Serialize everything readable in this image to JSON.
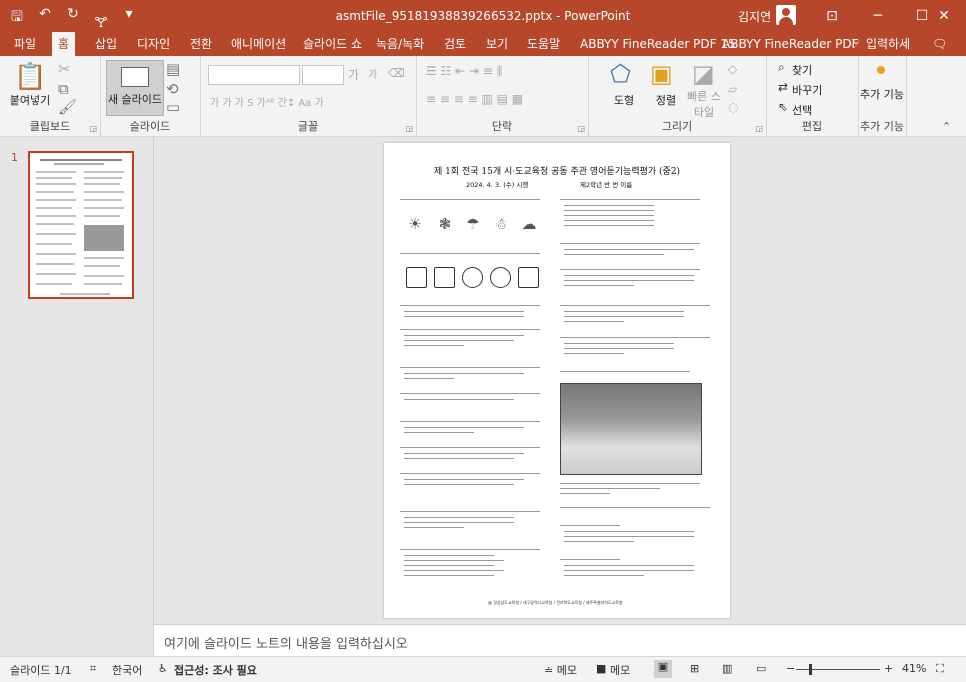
{
  "window": {
    "title": "asmtFile_95181938839266532.pptx  -  PowerPoint",
    "user": "김지연",
    "controls": {
      "ribbon_display": "⊡",
      "minimize": "─",
      "maximize": "☐",
      "close": "✕"
    }
  },
  "qat": {
    "save": "🖫",
    "undo": "↶",
    "redo": "↻",
    "present": "🝖",
    "more": "▾"
  },
  "menu": {
    "tabs": [
      "파일",
      "홈",
      "삽입",
      "디자인",
      "전환",
      "애니메이션",
      "슬라이드 쇼",
      "녹음/녹화",
      "검토",
      "보기",
      "도움말",
      "ABBYY FineReader PDF 15",
      "ABBYY FineReader PDF"
    ],
    "active": "홈",
    "search": "입력하세",
    "comment_icon": "🗨"
  },
  "ribbon": {
    "clipboard": {
      "paste": "붙여넣기",
      "label": "클립보드"
    },
    "slides": {
      "new_slide": "새 슬라이드",
      "label": "슬라이드"
    },
    "font": {
      "label": "글꼴",
      "grow": "가",
      "shrink": "가",
      "aa": "Aa",
      "color_a": "가",
      "font_row": "가 가 가 S 가ᴬᴮ 간↕ Aa 가"
    },
    "paragraph": {
      "label": "단락"
    },
    "drawing": {
      "shapes": "도형",
      "arrange": "정렬",
      "quick_styles": "빠른 스타일",
      "label": "그리기"
    },
    "editing": {
      "find": "찾기",
      "replace": "바꾸기",
      "select": "선택",
      "label": "편집"
    },
    "addins": {
      "button": "추가 기능",
      "label": "추가 기능"
    }
  },
  "thumbnails": {
    "number": "1"
  },
  "slide": {
    "title": "제 1회 전국 15개 시·도교육청 공동 주관 영어듣기능력평가 (중2)",
    "date": "2024. 4. 3. (수) 시행",
    "grade": "제2학년 반 번 이름",
    "footer": "@ 경상남도교육청 / 대구광역시교육청 / 전라북도교육청 / 제주특별자치도교육청"
  },
  "notes": {
    "placeholder": "여기에 슬라이드 노트의 내용을 입력하십시오"
  },
  "status": {
    "slide_count": "슬라이드 1/1",
    "language": "한국어",
    "accessibility": "접근성: 조사 필요",
    "notes_btn": "≐ 메모",
    "comments_btn": "메모",
    "zoom_minus": "−",
    "zoom_plus": "+",
    "zoom": "41%",
    "zoom_level": 0.41
  },
  "colors": {
    "accent": "#b7472a",
    "ribbon_bg": "#f3f3f3",
    "app_bg": "#e6e6e6"
  }
}
